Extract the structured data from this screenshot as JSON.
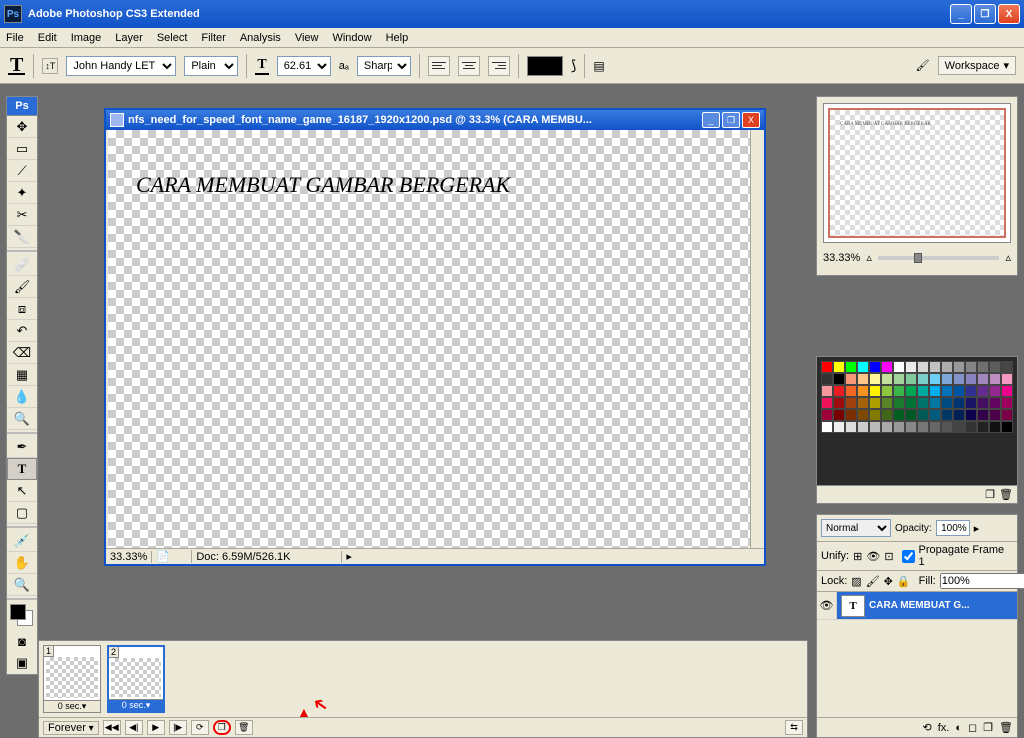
{
  "window": {
    "title": "Adobe Photoshop CS3 Extended",
    "logo": "Ps"
  },
  "window_controls": {
    "min": "_",
    "max": "❐",
    "close": "X"
  },
  "menu": [
    "File",
    "Edit",
    "Image",
    "Layer",
    "Select",
    "Filter",
    "Analysis",
    "View",
    "Window",
    "Help"
  ],
  "options": {
    "font": "John Handy LET",
    "style": "Plain",
    "size": "62.61 pt",
    "aa_label": "aₐ",
    "antialias": "Sharp",
    "workspace": "Workspace"
  },
  "document": {
    "title": "nfs_need_for_speed_font_name_game_16187_1920x1200.psd @ 33.3% (CARA MEMBU...",
    "text": "CARA MEMBUAT GAMBAR BERGERAK",
    "zoom": "33.33%",
    "doc_info": "Doc: 6.59M/526.1K"
  },
  "animation": {
    "frames": [
      {
        "num": "1",
        "delay": "0 sec."
      },
      {
        "num": "2",
        "delay": "0 sec."
      }
    ],
    "loop": "Forever",
    "buttons": {
      "first": "◀◀",
      "prev": "◀|",
      "play": "▶",
      "next": "|▶",
      "tween": "⟳",
      "dup": "❐",
      "trash": "🗑"
    }
  },
  "navigator": {
    "zoom": "33.33%"
  },
  "swatch_colors": [
    "#ff0000",
    "#ffff00",
    "#00ff00",
    "#00ffff",
    "#0000ff",
    "#ff00ff",
    "#ffffff",
    "#ebebeb",
    "#d6d6d6",
    "#c2c2c2",
    "#adadad",
    "#999999",
    "#858585",
    "#707070",
    "#5c5c5c",
    "#474747",
    "#333333",
    "#000000",
    "#f7977a",
    "#fdc68a",
    "#fff79a",
    "#c4df9b",
    "#a2d39c",
    "#82ca9d",
    "#7bcdc8",
    "#6ecff6",
    "#7ea7d8",
    "#8493ca",
    "#8882be",
    "#a187be",
    "#bc8dbf",
    "#f49ac2",
    "#f6989d",
    "#ed1c24",
    "#f26522",
    "#f7941d",
    "#fff200",
    "#8dc73f",
    "#39b54a",
    "#00a651",
    "#00a99d",
    "#00aeef",
    "#0072bc",
    "#0054a6",
    "#2e3192",
    "#662d91",
    "#92278f",
    "#ec008c",
    "#ed145b",
    "#9e0b0f",
    "#a0410d",
    "#a36209",
    "#aba000",
    "#598527",
    "#1a7b30",
    "#007236",
    "#00746b",
    "#0076a3",
    "#004b80",
    "#003471",
    "#1b1464",
    "#440e62",
    "#630460",
    "#9e005d",
    "#9e0039",
    "#790000",
    "#7b2e00",
    "#7d4900",
    "#827b00",
    "#406618",
    "#005e20",
    "#005826",
    "#005952",
    "#005b7f",
    "#003663",
    "#002157",
    "#0d004c",
    "#32004b",
    "#4b0049",
    "#7b0046",
    "#fff",
    "#eee",
    "#ddd",
    "#ccc",
    "#bbb",
    "#aaa",
    "#999",
    "#888",
    "#777",
    "#666",
    "#555",
    "#444",
    "#333",
    "#222",
    "#111",
    "#000"
  ],
  "layers": {
    "blend": "Normal",
    "opacity_label": "Opacity:",
    "opacity": "100%",
    "unify": "Unify:",
    "propagate": "Propagate Frame 1",
    "lock_label": "Lock:",
    "fill_label": "Fill:",
    "fill": "100%",
    "items": [
      {
        "name": "CARA MEMBUAT G...",
        "type": "T"
      }
    ],
    "foot_icons": [
      "⟲",
      "fx.",
      "◐",
      "◻",
      "❐",
      "🗑"
    ]
  }
}
